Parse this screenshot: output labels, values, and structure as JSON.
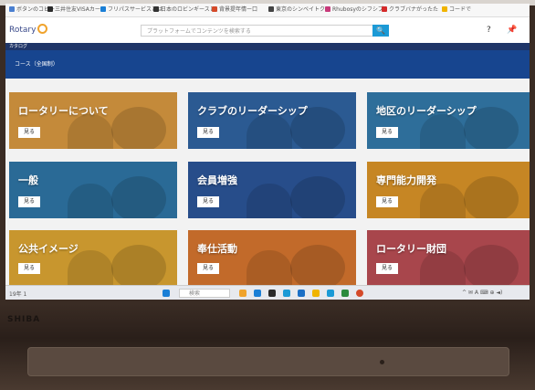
{
  "bookmarks": [
    "ボタンのコピー",
    "三井住友VISAカード",
    "フリパスサービスとは",
    "日本のロビンギースと",
    "背景提年情ー口",
    "東京のシンベイトク",
    "Rhubosyのシフシブ",
    "クラブバナがったた",
    "コードで"
  ],
  "header": {
    "logo_text": "Rotary",
    "search_placeholder": "プラットフォームでコンテンツを検索する",
    "search_icon": "🔍",
    "help_icon": "?",
    "pin_icon": "📌"
  },
  "navbar": {
    "label": "カタログ"
  },
  "banner": {
    "title": "コース（全国制）"
  },
  "cards": [
    {
      "title": "ロータリーについて",
      "button": "見る",
      "color": "#c48a3a"
    },
    {
      "title": "クラブのリーダーシップ",
      "button": "見る",
      "color": "#2b5a92"
    },
    {
      "title": "地区のリーダーシップ",
      "button": "見る",
      "color": "#2e6e9a"
    },
    {
      "title": "一般",
      "button": "見る",
      "color": "#2a6a96"
    },
    {
      "title": "会員増強",
      "button": "見る",
      "color": "#274d8a"
    },
    {
      "title": "専門能力開発",
      "button": "見る",
      "color": "#c68624"
    },
    {
      "title": "公共イメージ",
      "button": "見る",
      "color": "#c8962e"
    },
    {
      "title": "奉仕活動",
      "button": "見る",
      "color": "#c26a2a"
    },
    {
      "title": "ロータリー財団",
      "button": "見る",
      "color": "#a8464c"
    }
  ],
  "taskbar": {
    "left_text": "19年 1",
    "search_text": "検索",
    "icons": [
      "#f0a32c",
      "#1b7fd6",
      "#2a2a2a",
      "#1b9ad6",
      "#1a6fc6",
      "#f0b400",
      "#1b9ad6",
      "#2b8a3e",
      "#d44a2a"
    ],
    "right_icons": "^ ✉ A ⌨ ⊕ ◄)"
  },
  "laptop": {
    "brand": "SHIBA"
  }
}
